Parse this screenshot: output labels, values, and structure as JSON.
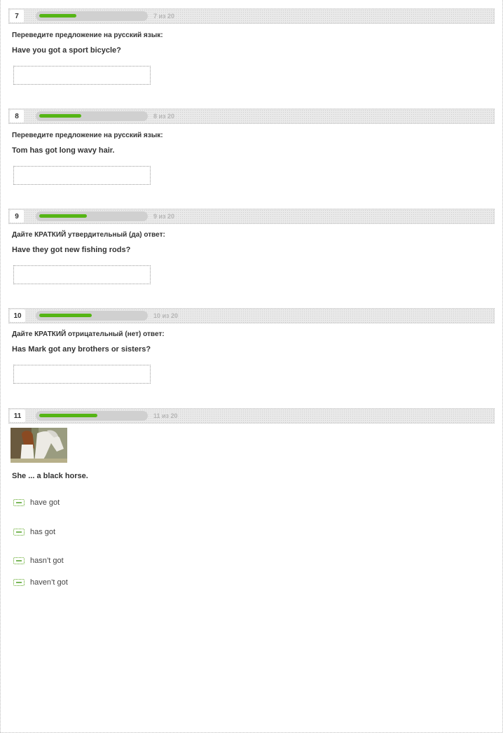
{
  "questions": [
    {
      "number": "7",
      "progress_text": "7 из 20",
      "progress_fraction": 0.35,
      "instruction": "Переведите предложение на русский язык:",
      "sentence": "Have you got a sport bicycle?",
      "answer_value": ""
    },
    {
      "number": "8",
      "progress_text": "8 из 20",
      "progress_fraction": 0.4,
      "instruction": "Переведите предложение на русский язык:",
      "sentence": "Tom has got long wavy hair.",
      "answer_value": ""
    },
    {
      "number": "9",
      "progress_text": "9 из 20",
      "progress_fraction": 0.45,
      "instruction": "Дайте КРАТКИЙ утвердительный (да) ответ:",
      "sentence": "Have they got new fishing rods?",
      "answer_value": ""
    },
    {
      "number": "10",
      "progress_text": "10 из 20",
      "progress_fraction": 0.5,
      "instruction": "Дайте КРАТКИЙ отрицательный (нет) ответ:",
      "sentence": "Has Mark got any brothers or sisters?",
      "answer_value": ""
    },
    {
      "number": "11",
      "progress_text": "11 из 20",
      "progress_fraction": 0.55,
      "sentence": "She ... a black horse.",
      "options": [
        "have got",
        "has got",
        "hasn’t got",
        "haven’t got"
      ]
    }
  ],
  "colors": {
    "progress_fill": "#55b515",
    "progress_track": "#d0d0d0",
    "header_bg": "#e9e9e9"
  }
}
